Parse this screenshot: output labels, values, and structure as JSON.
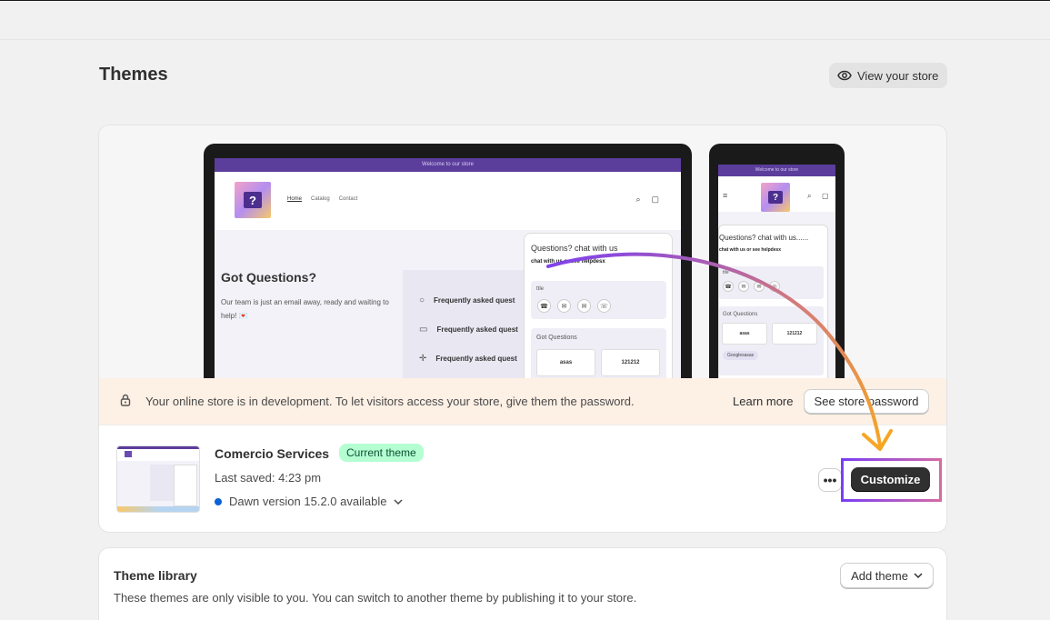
{
  "page": {
    "title": "Themes",
    "view_store_label": "View your store"
  },
  "preview": {
    "announcement": "Welcome to our store",
    "nav": [
      "Home",
      "Catalog",
      "Contact"
    ],
    "logo_glyph": "?",
    "hero_title": "Got Questions?",
    "hero_text": "Our team is just an email away, ready and waiting to help! 💌",
    "faq_items": [
      "Frequently asked quest",
      "Frequently asked quest",
      "Frequently asked quest"
    ],
    "widget": {
      "title": "Questions? chat with us",
      "subtitle": "chat with us or see helpdesx",
      "box_label": "ttle",
      "section_label": "Got Questions",
      "cells": [
        "asas",
        "121212"
      ]
    },
    "phone": {
      "announcement": "Welcome to our store",
      "title": "Questions? chat with us......",
      "subtitle": "chat with us or see helpdesx",
      "box_label": "ttle",
      "section_label": "Got Questions",
      "cells": [
        "asas",
        "121212"
      ],
      "chip": "Googlesasas"
    }
  },
  "banner": {
    "text": "Your online store is in development. To let visitors access your store, give them the password.",
    "learn_more": "Learn more",
    "password_button": "See store password"
  },
  "current_theme": {
    "name": "Comercio Services",
    "badge": "Current theme",
    "last_saved": "Last saved: 4:23 pm",
    "update": "Dawn version 15.2.0 available",
    "more_label": "•••",
    "customize_label": "Customize"
  },
  "library": {
    "title": "Theme library",
    "description": "These themes are only visible to you. You can switch to another theme by publishing it to your store.",
    "add_button": "Add theme"
  },
  "colors": {
    "accent": "#5b3d9c",
    "badge_bg": "#b4fed2",
    "banner_bg": "#fdf0e5",
    "primary_button": "#303030",
    "annotation_start": "#7b3ff2",
    "annotation_end": "#f5a623"
  },
  "icons": [
    "eye-icon",
    "lock-icon",
    "chevron-down-icon",
    "search-icon",
    "cart-icon",
    "menu-icon"
  ]
}
